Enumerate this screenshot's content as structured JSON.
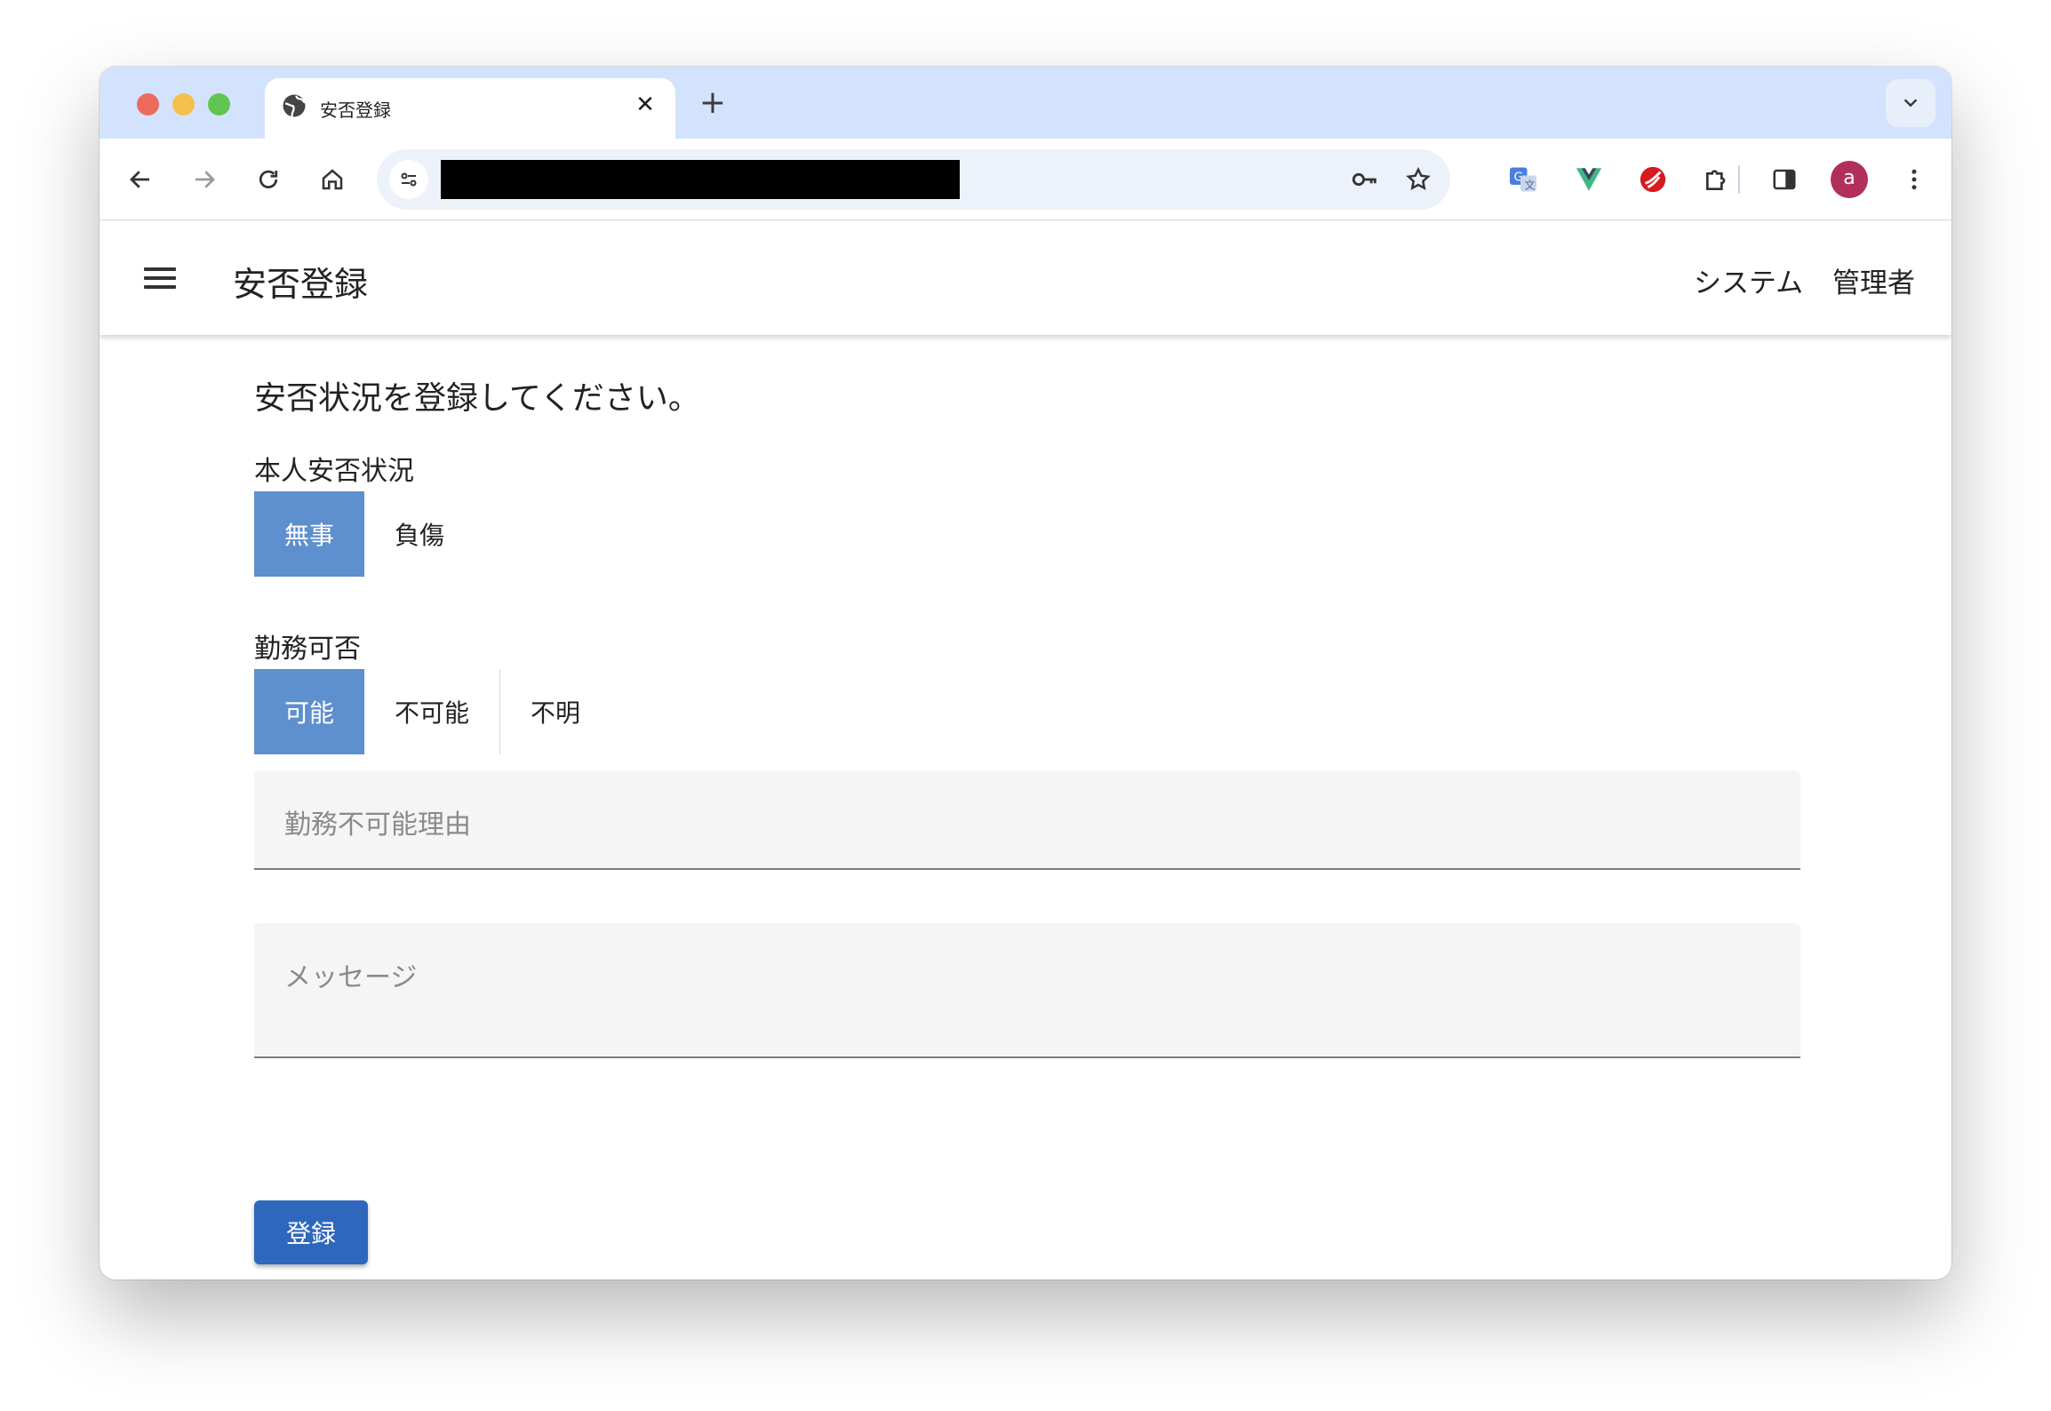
{
  "browser": {
    "tab_title": "安否登録",
    "tab_close": "✕",
    "new_tab": "+",
    "address_bar": {
      "url": ""
    },
    "profile_initial": "a",
    "colors": {
      "tabstrip": "#d3e3fd",
      "avatar": "#b0305a"
    }
  },
  "app": {
    "title": "安否登録",
    "nav": {
      "system": "システム",
      "admin": "管理者"
    }
  },
  "form": {
    "instruction": "安否状況を登録してください。",
    "personal_status": {
      "label": "本人安否状況",
      "options": [
        "無事",
        "負傷"
      ],
      "selected": "無事"
    },
    "work_availability": {
      "label": "勤務可否",
      "options": [
        "可能",
        "不可能",
        "不明"
      ],
      "selected": "可能"
    },
    "reason_field": {
      "placeholder": "勤務不可能理由",
      "value": ""
    },
    "message_field": {
      "placeholder": "メッセージ",
      "value": ""
    },
    "submit_label": "登録",
    "colors": {
      "selected": "#5e8fce",
      "submit": "#2f67bd"
    }
  }
}
